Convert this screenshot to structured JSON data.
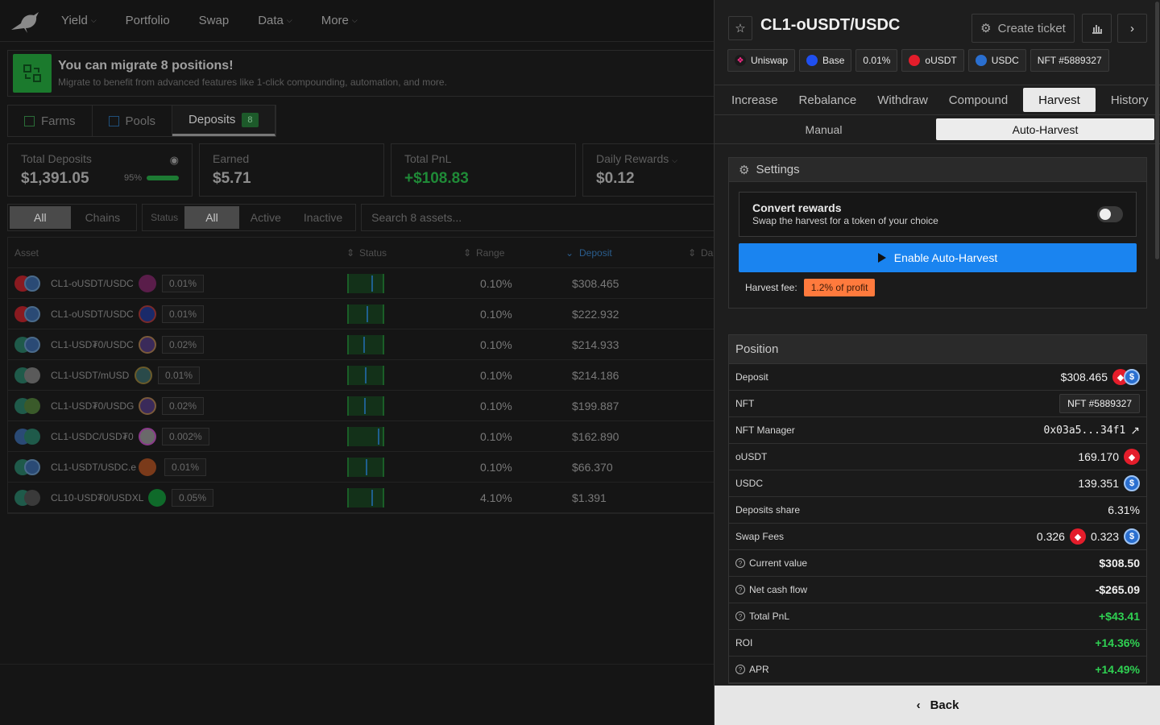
{
  "nav": {
    "items": [
      {
        "label": "Yield",
        "dropdown": true
      },
      {
        "label": "Portfolio",
        "dropdown": false
      },
      {
        "label": "Swap",
        "dropdown": false
      },
      {
        "label": "Data",
        "dropdown": true
      },
      {
        "label": "More",
        "dropdown": true
      }
    ]
  },
  "migrate": {
    "title": "You can migrate 8 positions!",
    "subtitle": "Migrate to benefit from advanced features like 1-click compounding, automation, and more."
  },
  "main_tabs": {
    "farms": "Farms",
    "pools": "Pools",
    "deposits": "Deposits",
    "deposits_count": "8"
  },
  "stats": {
    "total_deposits_label": "Total Deposits",
    "total_deposits": "$1,391.05",
    "total_deposits_pct": "95%",
    "earned_label": "Earned",
    "earned": "$5.71",
    "pnl_label": "Total PnL",
    "pnl": "+$108.83",
    "daily_label": "Daily Rewards",
    "daily": "$0.12"
  },
  "filters": {
    "all": "All",
    "chains": "Chains",
    "status_label": "Status",
    "status_all": "All",
    "active": "Active",
    "inactive": "Inactive",
    "search_placeholder": "Search 8 assets..."
  },
  "table": {
    "headers": {
      "asset": "Asset",
      "status": "Status",
      "range": "Range",
      "deposit": "Deposit",
      "da": "Da"
    },
    "rows": [
      {
        "name": "CL1-oUSDT/USDC",
        "fee": "0.01%",
        "range": "0.10%",
        "deposit": "$308.465"
      },
      {
        "name": "CL1-oUSDT/USDC",
        "fee": "0.01%",
        "range": "0.10%",
        "deposit": "$222.932"
      },
      {
        "name": "CL1-USD₮0/USDC",
        "fee": "0.02%",
        "range": "0.10%",
        "deposit": "$214.933"
      },
      {
        "name": "CL1-USDT/mUSD",
        "fee": "0.01%",
        "range": "0.10%",
        "deposit": "$214.186"
      },
      {
        "name": "CL1-USD₮0/USDG",
        "fee": "0.02%",
        "range": "0.10%",
        "deposit": "$199.887"
      },
      {
        "name": "CL1-USDC/USD₮0",
        "fee": "0.002%",
        "range": "0.10%",
        "deposit": "$162.890"
      },
      {
        "name": "CL1-USDT/USDC.e",
        "fee": "0.01%",
        "range": "0.10%",
        "deposit": "$66.370"
      },
      {
        "name": "CL10-USD₮0/USDXL",
        "fee": "0.05%",
        "range": "4.10%",
        "deposit": "$1.391"
      }
    ]
  },
  "panel": {
    "title": "CL1-oUSDT/USDC",
    "create_ticket": "Create ticket",
    "chips": {
      "dex": "Uniswap",
      "chain": "Base",
      "fee": "0.01%",
      "token0": "oUSDT",
      "token1": "USDC",
      "nft": "NFT #5889327"
    },
    "tabs": [
      "Increase",
      "Rebalance",
      "Withdraw",
      "Compound",
      "Harvest",
      "History"
    ],
    "subtabs": [
      "Manual",
      "Auto-Harvest"
    ],
    "settings": {
      "title": "Settings",
      "convert_title": "Convert rewards",
      "convert_sub": "Swap the harvest for a token of your choice",
      "enable_button": "Enable Auto-Harvest",
      "fee_label": "Harvest fee:",
      "fee_value": "1.2% of profit"
    },
    "position": {
      "title": "Position",
      "rows": {
        "deposit_label": "Deposit",
        "deposit": "$308.465",
        "nft_label": "NFT",
        "nft": "NFT #5889327",
        "manager_label": "NFT Manager",
        "manager": "0x03a5...34f1",
        "ousdt_label": "oUSDT",
        "ousdt": "169.170",
        "usdc_label": "USDC",
        "usdc": "139.351",
        "share_label": "Deposits share",
        "share": "6.31%",
        "fees_label": "Swap Fees",
        "fees0": "0.326",
        "fees1": "0.323",
        "current_label": "Current value",
        "current": "$308.50",
        "netflow_label": "Net cash flow",
        "netflow": "-$265.09",
        "pnl_label": "Total PnL",
        "pnl": "+$43.41",
        "roi_label": "ROI",
        "roi": "+14.36%",
        "apr_label": "APR",
        "apr": "+14.49%"
      }
    },
    "back": "Back"
  },
  "colors": {
    "accent_blue": "#1a84f0",
    "positive_green": "#2fd152",
    "fee_orange": "#ff7a3d",
    "usdt_red": "#e41d2b"
  }
}
